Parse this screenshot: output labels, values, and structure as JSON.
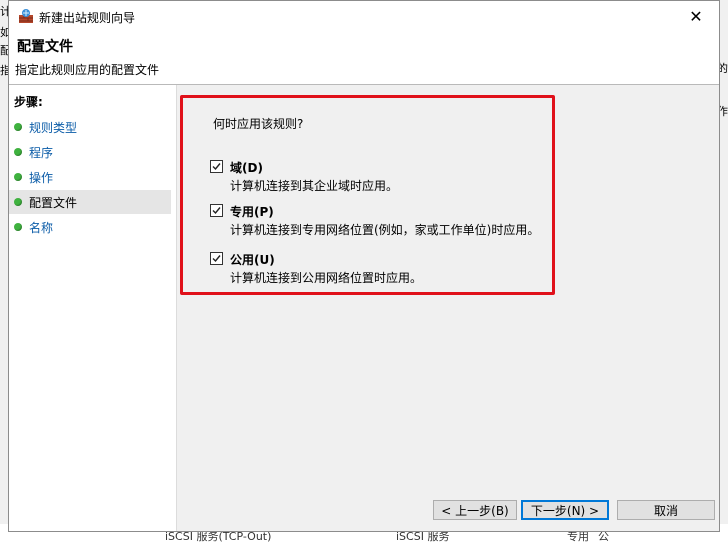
{
  "window": {
    "title": "新建出站规则向导",
    "close_glyph": "✕"
  },
  "header": {
    "title": "配置文件",
    "subtitle": "指定此规则应用的配置文件"
  },
  "sidebar": {
    "steps_label": "步骤:",
    "items": [
      {
        "label": "规则类型"
      },
      {
        "label": "程序"
      },
      {
        "label": "操作"
      },
      {
        "label": "配置文件"
      },
      {
        "label": "名称"
      }
    ]
  },
  "content": {
    "question": "何时应用该规则?",
    "options": [
      {
        "title": "域(D)",
        "desc": "计算机连接到其企业域时应用。",
        "checked": true
      },
      {
        "title": "专用(P)",
        "desc": "计算机连接到专用网络位置(例如，家或工作单位)时应用。",
        "checked": true
      },
      {
        "title": "公用(U)",
        "desc": "计算机连接到公用网络位置时应用。",
        "checked": true
      }
    ]
  },
  "buttons": {
    "back": "< 上一步(B)",
    "next": "下一步(N) >",
    "cancel": "取消"
  },
  "background": {
    "left_chars": [
      "计",
      "如",
      "配",
      "指"
    ],
    "right_chars": [
      "的",
      "作"
    ],
    "bottom": [
      "iSCSI 服务(TCP-Out)",
      "iSCSI 服务",
      "专用",
      "公"
    ]
  },
  "colors": {
    "highlight_border": "#e0101a",
    "step_dot": "#3fb23f",
    "link": "#0b5ca8"
  }
}
